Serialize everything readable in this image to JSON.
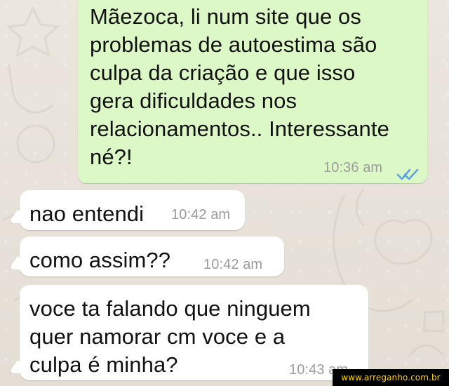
{
  "messages": [
    {
      "direction": "outgoing",
      "text": "Mãezoca, li num site que os\nproblemas de autoestima são\nculpa da criação e que isso\ngera dificuldades nos\nrelacionamentos.. Interessante\nné?!",
      "time": "10:36 am",
      "status_icon": "double-check-icon",
      "status_color": "#5aa1e8"
    },
    {
      "direction": "incoming",
      "text": "nao entendi",
      "time": "10:42 am"
    },
    {
      "direction": "incoming",
      "text": "como assim??",
      "time": "10:42 am"
    },
    {
      "direction": "incoming",
      "text": "voce ta falando que ninguem\nquer namorar cm voce e a\nculpa é minha?",
      "time": "10:43 am"
    }
  ],
  "watermark": {
    "text": "www.arreganho.com.br"
  },
  "colors": {
    "outgoing_bubble": "#dcf8c6",
    "incoming_bubble": "#ffffff",
    "chat_background": "#e8e3da",
    "timestamp": "#9c9c9c",
    "watermark_background": "#000000",
    "watermark_text": "#ffd200"
  }
}
